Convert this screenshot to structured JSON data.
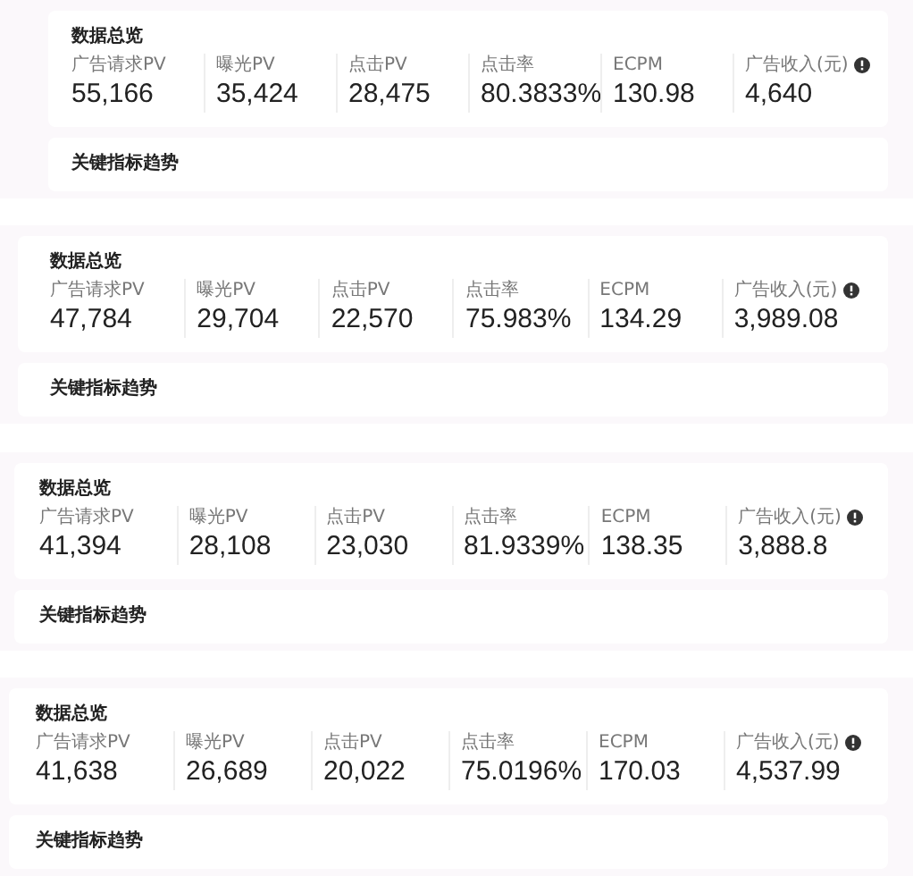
{
  "panels": [
    {
      "overview_title": "数据总览",
      "metrics": [
        {
          "label": "广告请求PV",
          "value": "55,166"
        },
        {
          "label": "曝光PV",
          "value": "35,424"
        },
        {
          "label": "点击PV",
          "value": "28,475"
        },
        {
          "label": "点击率",
          "value": "80.3833%"
        },
        {
          "label": "ECPM",
          "value": "130.98"
        },
        {
          "label": "广告收入(元)",
          "value": "4,640",
          "info": true
        }
      ],
      "trend_title": "关键指标趋势"
    },
    {
      "overview_title": "数据总览",
      "metrics": [
        {
          "label": "广告请求PV",
          "value": "47,784"
        },
        {
          "label": "曝光PV",
          "value": "29,704"
        },
        {
          "label": "点击PV",
          "value": "22,570"
        },
        {
          "label": "点击率",
          "value": "75.983%"
        },
        {
          "label": "ECPM",
          "value": "134.29"
        },
        {
          "label": "广告收入(元)",
          "value": "3,989.08",
          "info": true
        }
      ],
      "trend_title": "关键指标趋势"
    },
    {
      "overview_title": "数据总览",
      "metrics": [
        {
          "label": "广告请求PV",
          "value": "41,394"
        },
        {
          "label": "曝光PV",
          "value": "28,108"
        },
        {
          "label": "点击PV",
          "value": "23,030"
        },
        {
          "label": "点击率",
          "value": "81.9339%"
        },
        {
          "label": "ECPM",
          "value": "138.35"
        },
        {
          "label": "广告收入(元)",
          "value": "3,888.8",
          "info": true
        }
      ],
      "trend_title": "关键指标趋势"
    },
    {
      "overview_title": "数据总览",
      "metrics": [
        {
          "label": "广告请求PV",
          "value": "41,638"
        },
        {
          "label": "曝光PV",
          "value": "26,689"
        },
        {
          "label": "点击PV",
          "value": "20,022"
        },
        {
          "label": "点击率",
          "value": "75.0196%"
        },
        {
          "label": "ECPM",
          "value": "170.03"
        },
        {
          "label": "广告收入(元)",
          "value": "4,537.99",
          "info": true
        }
      ],
      "trend_title": "关键指标趋势"
    }
  ]
}
